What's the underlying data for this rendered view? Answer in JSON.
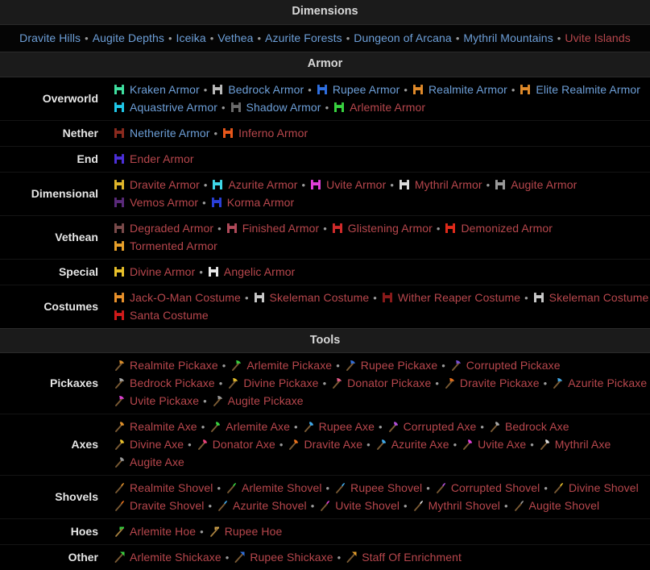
{
  "sections": [
    {
      "title": "Dimensions",
      "type": "inline",
      "items": [
        {
          "label": "Dravite Hills",
          "color": "blue"
        },
        {
          "label": "Augite Depths",
          "color": "blue"
        },
        {
          "label": "Iceika",
          "color": "blue"
        },
        {
          "label": "Vethea",
          "color": "blue"
        },
        {
          "label": "Azurite Forests",
          "color": "blue"
        },
        {
          "label": "Dungeon of Arcana",
          "color": "blue"
        },
        {
          "label": "Mythril Mountains",
          "color": "blue"
        },
        {
          "label": "Uvite Islands",
          "color": "red"
        }
      ]
    },
    {
      "title": "Armor",
      "type": "rows",
      "rows": [
        {
          "label": "Overworld",
          "icon": "chestplate-icon",
          "items": [
            {
              "label": "Kraken Armor",
              "color": "blue",
              "icon_color": "#3fe0a0"
            },
            {
              "label": "Bedrock Armor",
              "color": "blue",
              "icon_color": "#b9b9b9"
            },
            {
              "label": "Rupee Armor",
              "color": "blue",
              "icon_color": "#2f6fe0"
            },
            {
              "label": "Realmite Armor",
              "color": "blue",
              "icon_color": "#e08a2a"
            },
            {
              "label": "Elite Realmite Armor",
              "color": "blue",
              "icon_color": "#e08a2a"
            },
            {
              "label": "Aquastrive Armor",
              "color": "blue",
              "icon_color": "#1fc7e8"
            },
            {
              "label": "Shadow Armor",
              "color": "blue",
              "icon_color": "#6a6a6a"
            },
            {
              "label": "Arlemite Armor",
              "color": "red",
              "icon_color": "#38d23f"
            }
          ]
        },
        {
          "label": "Nether",
          "icon": "chestplate-icon",
          "items": [
            {
              "label": "Netherite Armor",
              "color": "blue",
              "icon_color": "#8a2a1e"
            },
            {
              "label": "Inferno Armor",
              "color": "red",
              "icon_color": "#e8571b"
            }
          ]
        },
        {
          "label": "End",
          "icon": "chestplate-icon",
          "items": [
            {
              "label": "Ender Armor",
              "color": "red",
              "icon_color": "#4b2fd8"
            }
          ]
        },
        {
          "label": "Dimensional",
          "icon": "chestplate-icon",
          "items": [
            {
              "label": "Dravite Armor",
              "color": "red",
              "icon_color": "#e0b52a"
            },
            {
              "label": "Azurite Armor",
              "color": "red",
              "icon_color": "#3fd8e8"
            },
            {
              "label": "Uvite Armor",
              "color": "red",
              "icon_color": "#e03fd8"
            },
            {
              "label": "Mythril Armor",
              "color": "red",
              "icon_color": "#dcdcdc"
            },
            {
              "label": "Augite Armor",
              "color": "red",
              "icon_color": "#9a9a9a"
            },
            {
              "label": "Vemos Armor",
              "color": "red",
              "icon_color": "#5a2a7a"
            },
            {
              "label": "Korma Armor",
              "color": "red",
              "icon_color": "#2a3fd8"
            }
          ]
        },
        {
          "label": "Vethean",
          "icon": "chestplate-icon",
          "items": [
            {
              "label": "Degraded Armor",
              "color": "red",
              "icon_color": "#7a4a4a"
            },
            {
              "label": "Finished Armor",
              "color": "red",
              "icon_color": "#b04a5a"
            },
            {
              "label": "Glistening Armor",
              "color": "red",
              "icon_color": "#d02a2a"
            },
            {
              "label": "Demonized Armor",
              "color": "red",
              "icon_color": "#e02a1a"
            },
            {
              "label": "Tormented Armor",
              "color": "red",
              "icon_color": "#e8a02a"
            }
          ]
        },
        {
          "label": "Special",
          "icon": "chestplate-icon",
          "items": [
            {
              "label": "Divine Armor",
              "color": "red",
              "icon_color": "#e8c02a"
            },
            {
              "label": "Angelic Armor",
              "color": "red",
              "icon_color": "#e8e8e8"
            }
          ]
        },
        {
          "label": "Costumes",
          "icon": "chestplate-icon",
          "items": [
            {
              "label": "Jack-O-Man Costume",
              "color": "red",
              "icon_color": "#e8902a"
            },
            {
              "label": "Skeleman Costume",
              "color": "red",
              "icon_color": "#c8c8c8"
            },
            {
              "label": "Wither Reaper Costume",
              "color": "red",
              "icon_color": "#8a1a1a"
            },
            {
              "label": "Skeleman Costume",
              "color": "red",
              "icon_color": "#c8c8c8"
            },
            {
              "label": "Santa Costume",
              "color": "red",
              "icon_color": "#d01a1a"
            }
          ]
        }
      ]
    },
    {
      "title": "Tools",
      "type": "rows",
      "rows": [
        {
          "label": "Pickaxes",
          "icon": "pickaxe-icon",
          "items": [
            {
              "label": "Realmite Pickaxe",
              "color": "red",
              "icon_color": "#e0902a"
            },
            {
              "label": "Arlemite Pickaxe",
              "color": "red",
              "icon_color": "#38d23f"
            },
            {
              "label": "Rupee Pickaxe",
              "color": "red",
              "icon_color": "#2f6fe0"
            },
            {
              "label": "Corrupted Pickaxe",
              "color": "red",
              "icon_color": "#7a4fd8"
            },
            {
              "label": "Bedrock Pickaxe",
              "color": "red",
              "icon_color": "#a8a8a8"
            },
            {
              "label": "Divine Pickaxe",
              "color": "red",
              "icon_color": "#e8c02a"
            },
            {
              "label": "Donator Pickaxe",
              "color": "red",
              "icon_color": "#e85a8a"
            },
            {
              "label": "Dravite Pickaxe",
              "color": "red",
              "icon_color": "#e8701a"
            },
            {
              "label": "Azurite Pickaxe",
              "color": "red",
              "icon_color": "#3fa8e8"
            },
            {
              "label": "Uvite Pickaxe",
              "color": "red",
              "icon_color": "#e03fd8"
            },
            {
              "label": "Augite Pickaxe",
              "color": "red",
              "icon_color": "#9a9a9a"
            }
          ]
        },
        {
          "label": "Axes",
          "icon": "axe-icon",
          "items": [
            {
              "label": "Realmite Axe",
              "color": "red",
              "icon_color": "#e0902a"
            },
            {
              "label": "Arlemite Axe",
              "color": "red",
              "icon_color": "#38d23f"
            },
            {
              "label": "Rupee Axe",
              "color": "red",
              "icon_color": "#3fa8e8"
            },
            {
              "label": "Corrupted Axe",
              "color": "red",
              "icon_color": "#b04fd8"
            },
            {
              "label": "Bedrock Axe",
              "color": "red",
              "icon_color": "#a8a8a8"
            },
            {
              "label": "Divine Axe",
              "color": "red",
              "icon_color": "#e8c02a"
            },
            {
              "label": "Donator Axe",
              "color": "red",
              "icon_color": "#e8407a"
            },
            {
              "label": "Dravite Axe",
              "color": "red",
              "icon_color": "#e8701a"
            },
            {
              "label": "Azurite Axe",
              "color": "red",
              "icon_color": "#3fa8e8"
            },
            {
              "label": "Uvite Axe",
              "color": "red",
              "icon_color": "#e03fd8"
            },
            {
              "label": "Mythril Axe",
              "color": "red",
              "icon_color": "#dcdcdc"
            },
            {
              "label": "Augite Axe",
              "color": "red",
              "icon_color": "#9a9a9a"
            }
          ]
        },
        {
          "label": "Shovels",
          "icon": "shovel-icon",
          "items": [
            {
              "label": "Realmite Shovel",
              "color": "red",
              "icon_color": "#e0902a"
            },
            {
              "label": "Arlemite Shovel",
              "color": "red",
              "icon_color": "#38d23f"
            },
            {
              "label": "Rupee Shovel",
              "color": "red",
              "icon_color": "#3fa8e8"
            },
            {
              "label": "Corrupted Shovel",
              "color": "red",
              "icon_color": "#b04fd8"
            },
            {
              "label": "Divine Shovel",
              "color": "red",
              "icon_color": "#e8c02a"
            },
            {
              "label": "Dravite Shovel",
              "color": "red",
              "icon_color": "#e8701a"
            },
            {
              "label": "Azurite Shovel",
              "color": "red",
              "icon_color": "#3fa8e8"
            },
            {
              "label": "Uvite Shovel",
              "color": "red",
              "icon_color": "#e03fd8"
            },
            {
              "label": "Mythril Shovel",
              "color": "red",
              "icon_color": "#dcdcdc"
            },
            {
              "label": "Augite Shovel",
              "color": "red",
              "icon_color": "#9a9a9a"
            }
          ]
        },
        {
          "label": "Hoes",
          "icon": "hoe-icon",
          "items": [
            {
              "label": "Arlemite Hoe",
              "color": "red",
              "icon_color": "#38d23f"
            },
            {
              "label": "Rupee Hoe",
              "color": "red",
              "icon_color": "#cfa24a"
            }
          ]
        },
        {
          "label": "Other",
          "icon": "shickaxe-icon",
          "items": [
            {
              "label": "Arlemite Shickaxe",
              "color": "red",
              "icon_color": "#38d23f"
            },
            {
              "label": "Rupee Shickaxe",
              "color": "red",
              "icon_color": "#2f6fe0"
            },
            {
              "label": "Staff Of Enrichment",
              "color": "red",
              "icon_color": "#e8a02a"
            }
          ]
        }
      ]
    }
  ],
  "separator": "•"
}
